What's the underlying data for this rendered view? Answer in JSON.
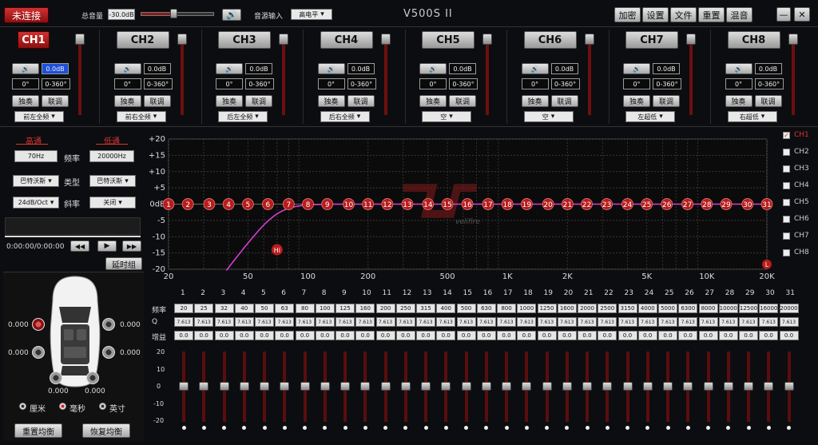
{
  "title": "V500S II",
  "connect_label": "未连接",
  "master": {
    "label": "总音量",
    "value": "-30.0dB"
  },
  "source": {
    "label": "音源输入",
    "value": "高电平"
  },
  "top_buttons": [
    "加密",
    "设置",
    "文件",
    "重置",
    "混音"
  ],
  "window_controls": {
    "minimize": "—",
    "close": "✕"
  },
  "channels": [
    {
      "name": "CH1",
      "gain": "0.0dB",
      "phase": "0°",
      "delay": "0-360°",
      "solo": "独奏",
      "link": "联调",
      "pos": "前左全频"
    },
    {
      "name": "CH2",
      "gain": "0.0dB",
      "phase": "0°",
      "delay": "0-360°",
      "solo": "独奏",
      "link": "联调",
      "pos": "前右全频"
    },
    {
      "name": "CH3",
      "gain": "0.0dB",
      "phase": "0°",
      "delay": "0-360°",
      "solo": "独奏",
      "link": "联调",
      "pos": "后左全频"
    },
    {
      "name": "CH4",
      "gain": "0.0dB",
      "phase": "0°",
      "delay": "0-360°",
      "solo": "独奏",
      "link": "联调",
      "pos": "后右全频"
    },
    {
      "name": "CH5",
      "gain": "0.0dB",
      "phase": "0°",
      "delay": "0-360°",
      "solo": "独奏",
      "link": "联调",
      "pos": "空"
    },
    {
      "name": "CH6",
      "gain": "0.0dB",
      "phase": "0°",
      "delay": "0-360°",
      "solo": "独奏",
      "link": "联调",
      "pos": "空"
    },
    {
      "name": "CH7",
      "gain": "0.0dB",
      "phase": "0°",
      "delay": "0-360°",
      "solo": "独奏",
      "link": "联调",
      "pos": "左超低"
    },
    {
      "name": "CH8",
      "gain": "0.0dB",
      "phase": "0°",
      "delay": "0-360°",
      "solo": "独奏",
      "link": "联调",
      "pos": "右超低"
    }
  ],
  "crossover": {
    "high_label": "高通",
    "low_label": "低通",
    "high_freq": "70Hz",
    "low_freq": "20000Hz",
    "freq_label": "频率",
    "type_label": "类型",
    "slope_label": "斜率",
    "high_type": "巴特沃斯",
    "low_type": "巴特沃斯",
    "high_slope": "24dB/Oct",
    "low_slope": "关闭"
  },
  "player": {
    "time": "0:00:00/0:00:00",
    "delay_group": "延时组"
  },
  "speakers": {
    "fl": "0.000",
    "fr": "0.000",
    "rl": "0.000",
    "rr": "0.000",
    "sl": "0.000",
    "sr": "0.000"
  },
  "units": [
    "厘米",
    "毫秒",
    "英寸"
  ],
  "bottom_buttons": {
    "reset": "重置均衡",
    "restore": "恢复均衡"
  },
  "graph": {
    "y_ticks": [
      "+20",
      "+15",
      "+10",
      "+5",
      "0dB",
      "-5",
      "-10",
      "-15",
      "-20"
    ],
    "x_ticks": [
      {
        "label": "20",
        "f": 20
      },
      {
        "label": "50",
        "f": 50
      },
      {
        "label": "100",
        "f": 100
      },
      {
        "label": "200",
        "f": 200
      },
      {
        "label": "500",
        "f": 500
      },
      {
        "label": "1K",
        "f": 1000
      },
      {
        "label": "2K",
        "f": 2000
      },
      {
        "label": "5K",
        "f": 5000
      },
      {
        "label": "10K",
        "f": 10000
      },
      {
        "label": "20K",
        "f": 20000
      }
    ],
    "hi_marker": "Hi",
    "lo_marker": "L",
    "watermark": "velifire"
  },
  "channel_checks": [
    {
      "label": "CH1",
      "checked": true
    },
    {
      "label": "CH2",
      "checked": false
    },
    {
      "label": "CH3",
      "checked": false
    },
    {
      "label": "CH4",
      "checked": false
    },
    {
      "label": "CH5",
      "checked": false
    },
    {
      "label": "CH6",
      "checked": false
    },
    {
      "label": "CH7",
      "checked": false
    },
    {
      "label": "CH8",
      "checked": false
    }
  ],
  "eq": {
    "row_labels": [
      "频率",
      "Q",
      "增益"
    ],
    "freqs": [
      "20",
      "25",
      "32",
      "40",
      "50",
      "63",
      "80",
      "100",
      "125",
      "160",
      "200",
      "250",
      "315",
      "400",
      "500",
      "630",
      "800",
      "1000",
      "1250",
      "1600",
      "2000",
      "2500",
      "3150",
      "4000",
      "5000",
      "6300",
      "8000",
      "10000",
      "12500",
      "16000",
      "20000"
    ],
    "q": "7.613",
    "gain": "0.0",
    "gain_ticks": [
      "20",
      "10",
      "0",
      "-10",
      "-20"
    ]
  },
  "colors": {
    "accent": "#c81e1e",
    "curve": "#d63bd6",
    "node": "#b81c1c"
  }
}
